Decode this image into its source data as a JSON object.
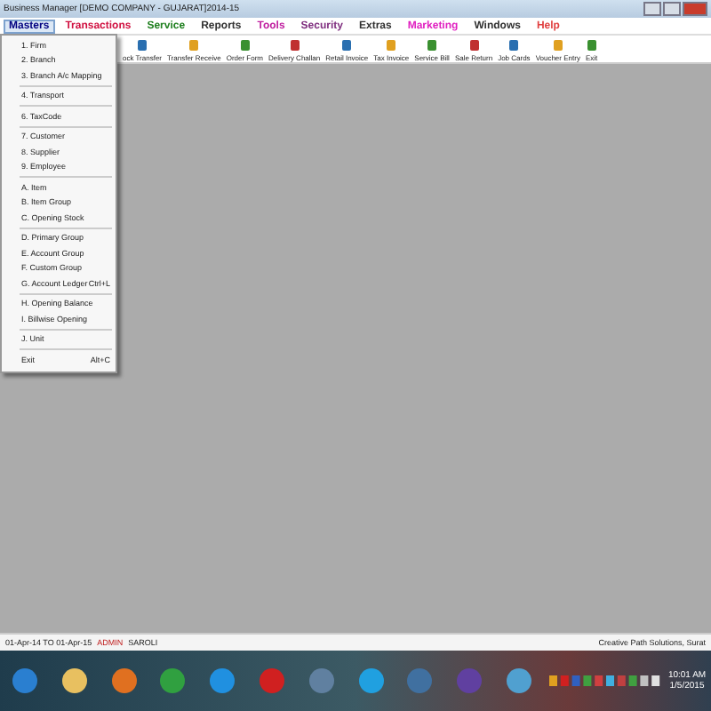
{
  "window": {
    "title": "Business Manager [DEMO COMPANY - GUJARAT]2014-15"
  },
  "menu": [
    {
      "label": "Masters",
      "selected": true,
      "color": "#000080"
    },
    {
      "label": "Transactions",
      "selected": false,
      "color": "#d01040"
    },
    {
      "label": "Service",
      "selected": false,
      "color": "#208020"
    },
    {
      "label": "Reports",
      "selected": false,
      "color": "#303030"
    },
    {
      "label": "Tools",
      "selected": false,
      "color": "#c020a0"
    },
    {
      "label": "Security",
      "selected": false,
      "color": "#803080"
    },
    {
      "label": "Extras",
      "selected": false,
      "color": "#303030"
    },
    {
      "label": "Marketing",
      "selected": false,
      "color": "#e020c0"
    },
    {
      "label": "Windows",
      "selected": false,
      "color": "#303030"
    },
    {
      "label": "Help",
      "selected": false,
      "color": "#e04040"
    }
  ],
  "toolbar": [
    "ock Transfer",
    "Transfer Receive",
    "Order Form",
    "Delivery Challan",
    "Retail Invoice",
    "Tax Invoice",
    "Service Bill",
    "Sale Return",
    "Job Cards",
    "Voucher Entry",
    "Exit"
  ],
  "dropdown": [
    {
      "kind": "item",
      "label": "1. Firm"
    },
    {
      "kind": "item",
      "label": "2. Branch"
    },
    {
      "kind": "item",
      "label": "3. Branch A/c Mapping"
    },
    {
      "kind": "separator"
    },
    {
      "kind": "item",
      "label": "4. Transport"
    },
    {
      "kind": "separator"
    },
    {
      "kind": "item",
      "label": "6. TaxCode"
    },
    {
      "kind": "separator"
    },
    {
      "kind": "item",
      "label": "7. Customer"
    },
    {
      "kind": "item",
      "label": "8. Supplier"
    },
    {
      "kind": "item",
      "label": "9. Employee"
    },
    {
      "kind": "separator"
    },
    {
      "kind": "item",
      "label": "A. Item"
    },
    {
      "kind": "item",
      "label": "B. Item Group"
    },
    {
      "kind": "item",
      "label": "C. Opening Stock"
    },
    {
      "kind": "separator"
    },
    {
      "kind": "item",
      "label": "D. Primary Group"
    },
    {
      "kind": "item",
      "label": "E. Account Group"
    },
    {
      "kind": "item",
      "label": "F. Custom Group"
    },
    {
      "kind": "item",
      "label": "G. Account Ledger",
      "shortcut": "Ctrl+L"
    },
    {
      "kind": "separator"
    },
    {
      "kind": "item",
      "label": "H. Opening Balance"
    },
    {
      "kind": "item",
      "label": "I. Billwise Opening"
    },
    {
      "kind": "separator"
    },
    {
      "kind": "item",
      "label": "J. Unit"
    },
    {
      "kind": "separator"
    },
    {
      "kind": "item",
      "label": "Exit",
      "shortcut": "Alt+C"
    }
  ],
  "status_bar": {
    "period": "01-Apr-14 TO 01-Apr-15",
    "user": "ADMIN",
    "name": "SAROLI",
    "company": "Creative Path Solutions, Surat"
  },
  "clock": {
    "time": "10:01 AM",
    "date": "1/5/2015"
  }
}
